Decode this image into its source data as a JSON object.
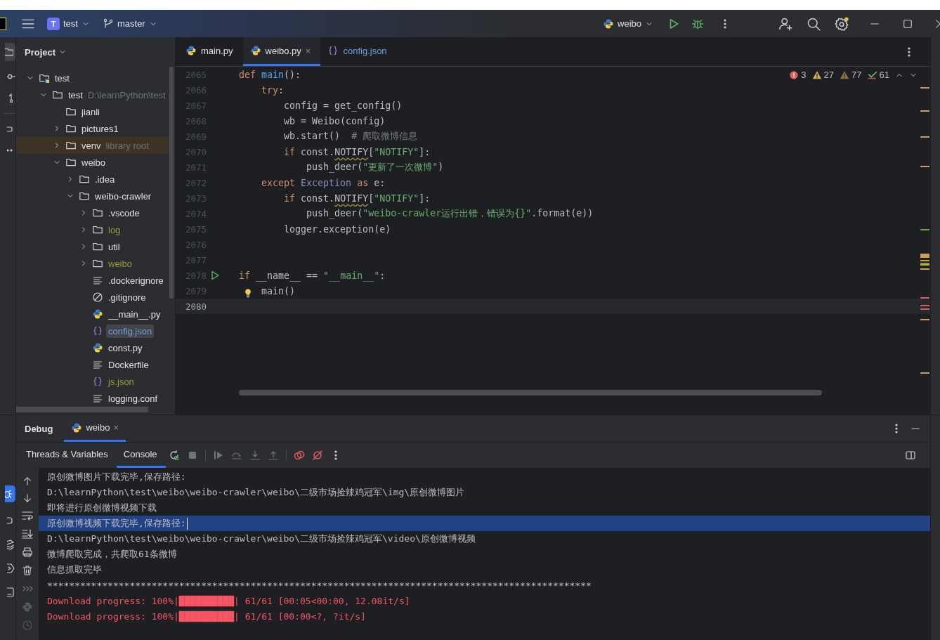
{
  "title_bar": {
    "project_badge": "T",
    "project": "test",
    "branch": "master",
    "run_config": "weibo"
  },
  "project_panel": {
    "title": "Project",
    "tree": [
      {
        "name": "test",
        "kind": "module",
        "expanded": true,
        "selected": false,
        "color": "#dfe1e5",
        "children": [
          {
            "name": "test",
            "hint": "D:\\learnPython\\test",
            "kind": "folder",
            "expanded": true,
            "selected": false,
            "color": "#dfe1e5",
            "children": [
              {
                "name": "jianli",
                "kind": "folder",
                "selected": false,
                "color": "#dfe1e5"
              },
              {
                "name": "pictures1",
                "kind": "folder",
                "expanded": false,
                "selected": false,
                "color": "#dfe1e5"
              },
              {
                "name": "venv",
                "hint": "library root",
                "kind": "library",
                "expanded": false,
                "selected": false,
                "color": "#dfe1e5"
              },
              {
                "name": "weibo",
                "kind": "folder",
                "expanded": true,
                "selected": false,
                "color": "#dfe1e5",
                "children": [
                  {
                    "name": ".idea",
                    "kind": "folder",
                    "expanded": false,
                    "selected": false,
                    "color": "#dfe1e5"
                  },
                  {
                    "name": "weibo-crawler",
                    "kind": "folder",
                    "expanded": true,
                    "selected": false,
                    "color": "#dfe1e5",
                    "children": [
                      {
                        "name": ".vscode",
                        "kind": "folder",
                        "expanded": false,
                        "selected": false,
                        "color": "#dfe1e5"
                      },
                      {
                        "name": "log",
                        "kind": "folder",
                        "expanded": false,
                        "selected": false,
                        "color": "#9c9a37"
                      },
                      {
                        "name": "util",
                        "kind": "folder",
                        "expanded": false,
                        "selected": false,
                        "color": "#dfe1e5"
                      },
                      {
                        "name": "weibo",
                        "kind": "folder",
                        "expanded": false,
                        "selected": false,
                        "color": "#9c9a37"
                      },
                      {
                        "name": ".dockerignore",
                        "kind": "text",
                        "selected": false,
                        "color": "#dfe1e5"
                      },
                      {
                        "name": ".gitignore",
                        "kind": "ignore",
                        "selected": false,
                        "color": "#dfe1e5"
                      },
                      {
                        "name": "__main__.py",
                        "kind": "python",
                        "selected": false,
                        "color": "#dfe1e5"
                      },
                      {
                        "name": "config.json",
                        "kind": "json",
                        "selected": true,
                        "color": "#6f9fd8"
                      },
                      {
                        "name": "const.py",
                        "kind": "python",
                        "selected": false,
                        "color": "#dfe1e5"
                      },
                      {
                        "name": "Dockerfile",
                        "kind": "text",
                        "selected": false,
                        "color": "#dfe1e5"
                      },
                      {
                        "name": "js.json",
                        "kind": "json",
                        "selected": false,
                        "color": "#9c9a37"
                      },
                      {
                        "name": "logging.conf",
                        "kind": "text",
                        "selected": false,
                        "color": "#dfe1e5"
                      }
                    ]
                  }
                ]
              }
            ]
          }
        ]
      }
    ]
  },
  "editor": {
    "tabs": [
      {
        "label": "main.py",
        "kind": "python",
        "selected": false,
        "color": "#dfe1e5"
      },
      {
        "label": "weibo.py",
        "kind": "python",
        "selected": true,
        "color": "#dfe1e5",
        "close": "×"
      },
      {
        "label": "config.json",
        "kind": "json",
        "selected": false,
        "color": "#6f9fd8"
      }
    ],
    "inspections": [
      {
        "kind": "error",
        "count": "3"
      },
      {
        "kind": "warning",
        "count": "27"
      },
      {
        "kind": "weak",
        "count": "77"
      },
      {
        "kind": "typo",
        "count": "61"
      }
    ],
    "lines": [
      {
        "number": "2065",
        "current": false,
        "tokens": [
          {
            "text": "def ",
            "kind": "kw"
          },
          {
            "text": "main",
            "kind": "fn"
          },
          {
            "text": "():",
            "kind": "plain"
          }
        ]
      },
      {
        "number": "2066",
        "current": false,
        "tokens": [
          {
            "text": "    try",
            "kind": "kw"
          },
          {
            "text": ":",
            "kind": "plain"
          }
        ]
      },
      {
        "number": "2067",
        "current": false,
        "tokens": [
          {
            "text": "        config = get_config()",
            "kind": "plain"
          }
        ]
      },
      {
        "number": "2068",
        "current": false,
        "tokens": [
          {
            "text": "        wb = Weibo(config)",
            "kind": "plain"
          }
        ]
      },
      {
        "number": "2069",
        "current": false,
        "tokens": [
          {
            "text": "        wb.start()  ",
            "kind": "plain"
          },
          {
            "text": "# 爬取微博信息",
            "kind": "comment"
          }
        ]
      },
      {
        "number": "2070",
        "current": false,
        "tokens": [
          {
            "text": "        if ",
            "kind": "kw"
          },
          {
            "text": "const.",
            "kind": "plain"
          },
          {
            "text": "NOTIFY",
            "kind": "squiggle"
          },
          {
            "text": "[",
            "kind": "plain"
          },
          {
            "text": "\"NOTIFY\"",
            "kind": "str"
          },
          {
            "text": "]:",
            "kind": "plain"
          }
        ]
      },
      {
        "number": "2071",
        "current": false,
        "tokens": [
          {
            "text": "            push_deer(",
            "kind": "plain"
          },
          {
            "text": "\"更新了一次微博\"",
            "kind": "str"
          },
          {
            "text": ")",
            "kind": "plain"
          }
        ]
      },
      {
        "number": "2072",
        "current": false,
        "tokens": [
          {
            "text": "    except ",
            "kind": "kw"
          },
          {
            "text": "Exception",
            "kind": "builtin"
          },
          {
            "text": " as ",
            "kind": "kw"
          },
          {
            "text": "e:",
            "kind": "plain"
          }
        ]
      },
      {
        "number": "2073",
        "current": false,
        "tokens": [
          {
            "text": "        if ",
            "kind": "kw"
          },
          {
            "text": "const.",
            "kind": "plain"
          },
          {
            "text": "NOTIFY",
            "kind": "squiggle"
          },
          {
            "text": "[",
            "kind": "plain"
          },
          {
            "text": "\"NOTIFY\"",
            "kind": "str"
          },
          {
            "text": "]:",
            "kind": "plain"
          }
        ]
      },
      {
        "number": "2074",
        "current": false,
        "tokens": [
          {
            "text": "            push_deer(",
            "kind": "plain"
          },
          {
            "text": "\"weibo-crawler运行出错，错误为{}\"",
            "kind": "str"
          },
          {
            "text": ".format(e))",
            "kind": "plain"
          }
        ]
      },
      {
        "number": "2075",
        "current": false,
        "tokens": [
          {
            "text": "        logger.exception(e)",
            "kind": "plain"
          }
        ]
      },
      {
        "number": "2076",
        "current": false
      },
      {
        "number": "2077",
        "current": false
      },
      {
        "number": "2078",
        "current": false,
        "run": true,
        "tokens": [
          {
            "text": "if ",
            "kind": "kw"
          },
          {
            "text": "__name__ == ",
            "kind": "plain"
          },
          {
            "text": "\"__main__\"",
            "kind": "str"
          },
          {
            "text": ":",
            "kind": "plain"
          }
        ]
      },
      {
        "number": "2079",
        "current": false,
        "bulb": true,
        "tokens": [
          {
            "text": "    main()",
            "kind": "plain"
          }
        ]
      },
      {
        "number": "2080",
        "current": true
      }
    ]
  },
  "debug_panel": {
    "title": "Debug",
    "sessions": [
      {
        "label": "weibo",
        "selected": true,
        "close": "×"
      }
    ],
    "tabs": [
      {
        "label": "Threads & Variables",
        "selected": false
      },
      {
        "label": "Console",
        "selected": true
      }
    ],
    "console": [
      {
        "text": "原创微博图片下载完毕,保存路径:",
        "kind": "out",
        "selected": false
      },
      {
        "text": "D:\\learnPython\\test\\weibo\\weibo-crawler\\weibo\\二级市场捡辣鸡冠军\\img\\原创微博图片",
        "kind": "out",
        "selected": false
      },
      {
        "text": "即将进行原创微博视频下载",
        "kind": "out",
        "selected": false
      },
      {
        "text": "原创微博视频下载完毕,保存路径:",
        "kind": "out",
        "selected": true
      },
      {
        "text": "D:\\learnPython\\test\\weibo\\weibo-crawler\\weibo\\二级市场捡辣鸡冠军\\video\\原创微博视频",
        "kind": "out",
        "selected": false
      },
      {
        "text": "微博爬取完成，共爬取61条微博",
        "kind": "out",
        "selected": false
      },
      {
        "text": "信息抓取完毕",
        "kind": "out",
        "selected": false
      },
      {
        "text": "***************************************************************************************************",
        "kind": "out",
        "selected": false
      },
      {
        "text": "Download progress: 100%|██████████| 61/61 [00:05<00:00, 12.08it/s]",
        "kind": "err",
        "selected": false
      },
      {
        "text": "Download progress: 100%|██████████| 61/61 [00:00<?, ?it/s]",
        "kind": "err",
        "selected": false
      }
    ]
  }
}
